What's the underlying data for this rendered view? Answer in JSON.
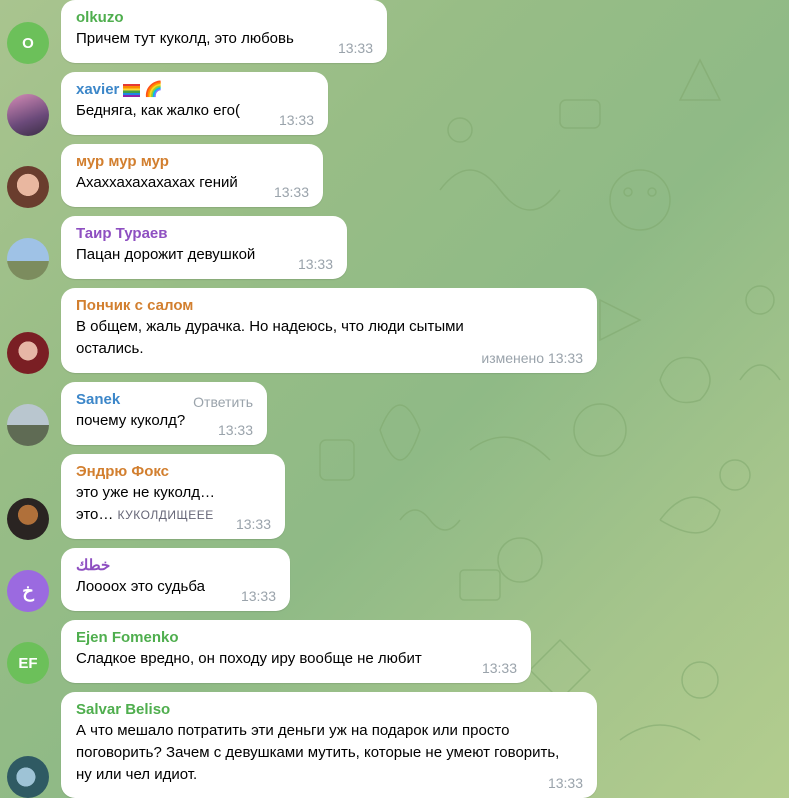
{
  "colors": {
    "bubble": "#ffffff",
    "time": "#9aa3ab"
  },
  "messages": [
    {
      "sender": "olkuzo",
      "sender_color": "#4fae4e",
      "avatar_letter": "O",
      "avatar_color": "#6cc05a",
      "text": "Причем тут куколд, это любовь",
      "time": "13:33"
    },
    {
      "sender": "xavier",
      "sender_color": "#3d87c9",
      "emoji": "🌈",
      "text": "Бедняга, как жалко его(",
      "time": "13:33"
    },
    {
      "sender": "мур мур мур",
      "sender_color": "#d27f2f",
      "text": "Ахаххахахахахах гений",
      "time": "13:33"
    },
    {
      "sender": "Таир Тураев",
      "sender_color": "#8e4fc1",
      "text": "Пацан дорожит девушкой",
      "time": "13:33"
    },
    {
      "sender": "Пончик с салом",
      "sender_color": "#d27f2f",
      "text": "В общем, жаль дурачка. Но надеюсь, что люди сытыми остались.",
      "edited_label": "изменено",
      "time": "13:33"
    },
    {
      "sender": "Sanek",
      "sender_color": "#3d87c9",
      "reply_label": "Ответить",
      "text": "почему куколд?",
      "time": "13:33"
    },
    {
      "sender": "Эндрю Фокс",
      "sender_color": "#d27f2f",
      "text_line1": "это уже не куколд…",
      "text_line2": "это…",
      "caps_text": "КУКОЛДИЩЕЕЕ",
      "time": "13:33"
    },
    {
      "sender": "خطك",
      "sender_color": "#8e4fc1",
      "avatar_letter": "خ",
      "avatar_color": "#9b6ae0",
      "text": "Лооoох это судьба",
      "time": "13:33"
    },
    {
      "sender": "Ejen Fomenko",
      "sender_color": "#4fae4e",
      "avatar_letter": "EF",
      "avatar_color": "#6cc05a",
      "text": "Сладкое вредно, он походу иру вообще не любит",
      "time": "13:33"
    },
    {
      "sender": "Salvar Beliso",
      "sender_color": "#4fae4e",
      "text": "А что мешало потратить эти деньги уж на подарок или просто поговорить? Зачем с девушками мутить, которые не умеют говорить, ну или чел идиот.",
      "time": "13:33"
    }
  ]
}
